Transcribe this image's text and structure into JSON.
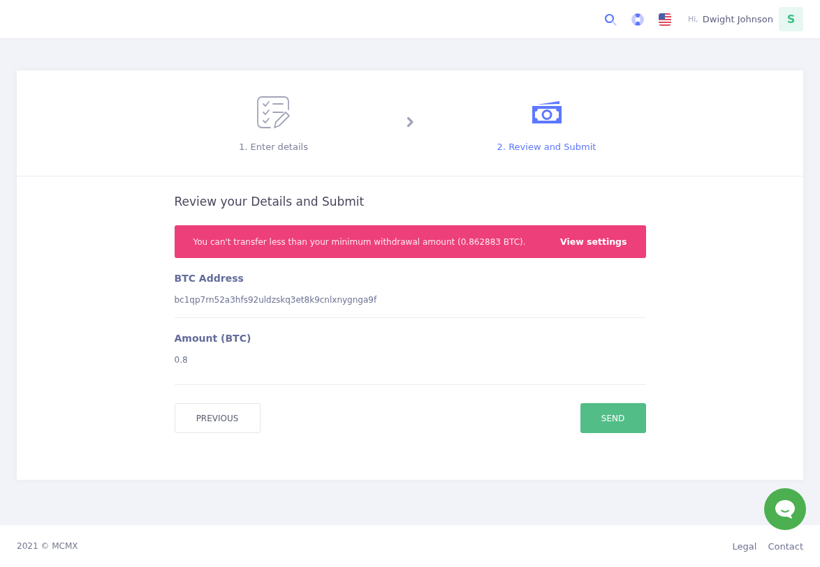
{
  "header": {
    "greeting": "Hi,",
    "user_name": "Dwight Johnson",
    "avatar_initial": "S"
  },
  "steps": [
    {
      "label": "1. Enter details",
      "selected": false
    },
    {
      "label": "2. Review and Submit",
      "selected": true
    }
  ],
  "review": {
    "title": "Review your Details and Submit",
    "alert": {
      "message": "You can't transfer less than your minimum withdrawal amount (0.862883 BTC).",
      "link": "View settings"
    },
    "fields": [
      {
        "label": "BTC Address",
        "value": "bc1qp7rn52a3hfs92uldzskq3et8k9cnlxnygnga9f"
      },
      {
        "label": "Amount (BTC)",
        "value": "0.8"
      }
    ],
    "buttons": [
      {
        "label": "PREVIOUS",
        "kind": "secondary"
      },
      {
        "label": "SEND",
        "kind": "primary"
      }
    ]
  },
  "footer": {
    "copyright": "2021 © MCMX",
    "links": [
      "Legal",
      "Contact"
    ]
  }
}
